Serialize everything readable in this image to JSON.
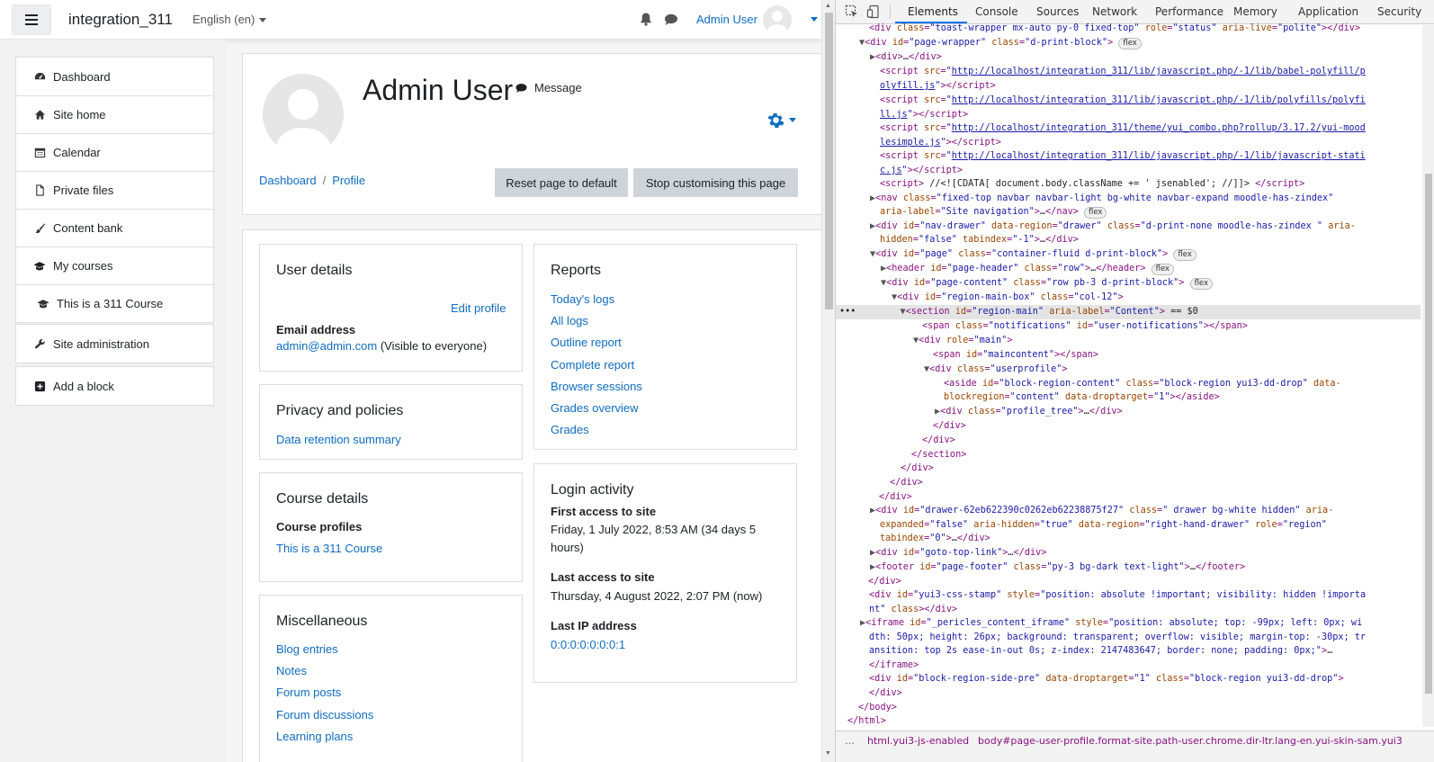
{
  "navbar": {
    "site_name": "integration_311",
    "language": "English (en)",
    "user_name": "Admin User"
  },
  "drawer": {
    "group1": [
      {
        "label": "Dashboard",
        "icon": "dashboard-icon"
      },
      {
        "label": "Site home",
        "icon": "home-icon"
      },
      {
        "label": "Calendar",
        "icon": "calendar-icon"
      },
      {
        "label": "Private files",
        "icon": "file-icon"
      },
      {
        "label": "Content bank",
        "icon": "paintbrush-icon"
      },
      {
        "label": "My courses",
        "icon": "graduation-cap-icon"
      },
      {
        "label": "This is a 311 Course",
        "icon": "graduation-cap-icon"
      }
    ],
    "site_admin": "Site administration",
    "add_block": "Add a block"
  },
  "header": {
    "name": "Admin User",
    "message": "Message",
    "breadcrumb": [
      "Dashboard",
      "Profile"
    ],
    "reset_button": "Reset page to default",
    "stop_button": "Stop customising this page"
  },
  "user_details": {
    "title": "User details",
    "edit_profile": "Edit profile",
    "email_label": "Email address",
    "email": "admin@admin.com",
    "email_visibility": "(Visible to everyone)"
  },
  "privacy": {
    "title": "Privacy and policies",
    "link": "Data retention summary"
  },
  "course_details": {
    "title": "Course details",
    "profiles_label": "Course profiles",
    "course": "This is a 311 Course"
  },
  "misc": {
    "title": "Miscellaneous",
    "links": [
      "Blog entries",
      "Notes",
      "Forum posts",
      "Forum discussions",
      "Learning plans"
    ]
  },
  "reports": {
    "title": "Reports",
    "links": [
      "Today's logs",
      "All logs",
      "Outline report",
      "Complete report",
      "Browser sessions",
      "Grades overview",
      "Grades"
    ]
  },
  "login": {
    "title": "Login activity",
    "first_label": "First access to site",
    "first_line1": "Friday, 1 July 2022, 8:53 AM  (34 days 5",
    "first_line2": "hours)",
    "last_label": "Last access to site",
    "last_value": "Thursday, 4 August 2022, 2:07 PM  (now)",
    "ip_label": "Last IP address",
    "ip_value": "0:0:0:0:0:0:0:1"
  },
  "devtools": {
    "tabs": [
      "Elements",
      "Console",
      "Sources",
      "Network",
      "Performance",
      "Memory",
      "Application",
      "Security"
    ],
    "badge": "flex",
    "bottom_crumbs": [
      "html.yui3-js-enabled",
      "body#page-user-profile.format-site.path-user.chrome.dir-ltr.lang-en.yui-skin-sam.yui3"
    ]
  },
  "colors": {
    "link": "#0f6cbf",
    "button_bg": "#ced4da",
    "selected_line": "#e4e4e4"
  }
}
